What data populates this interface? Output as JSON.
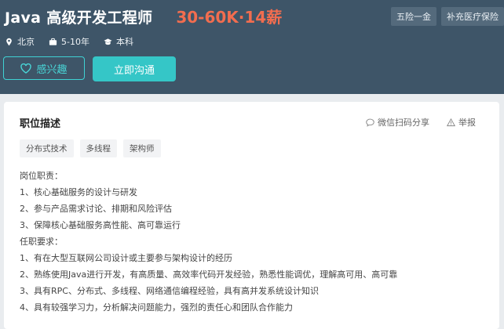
{
  "job": {
    "title": "Java 高级开发工程师",
    "salary": "30-60K·14薪",
    "welfare": [
      "五险一金",
      "补充医疗保险"
    ],
    "location": "北京",
    "experience": "5-10年",
    "education": "本科"
  },
  "actions": {
    "favorite_label": "感兴趣",
    "chat_label": "立即沟通"
  },
  "card": {
    "heading": "职位描述",
    "wechat_share": "微信扫码分享",
    "report": "举报",
    "tags": [
      "分布式技术",
      "多线程",
      "架构师"
    ],
    "description": [
      "岗位职责：",
      "1、核心基础服务的设计与研发",
      "2、参与产品需求讨论、排期和风险评估",
      "3、保障核心基础服务高性能、高可靠运行",
      "任职要求：",
      "1、有在大型互联网公司设计或主要参与架构设计的经历",
      "2、熟练使用Java进行开发，有高质量、高效率代码开发经验，熟悉性能调优，理解高可用、高可靠",
      "3、具有RPC、分布式、多线程、网络通信编程经验，具有高并发系统设计知识",
      "4、具有较强学习力，分析解决问题能力，强烈的责任心和团队合作能力"
    ]
  },
  "colors": {
    "header_bg": "#3e5568",
    "salary": "#f26d4f",
    "accent": "#35c6c7"
  }
}
